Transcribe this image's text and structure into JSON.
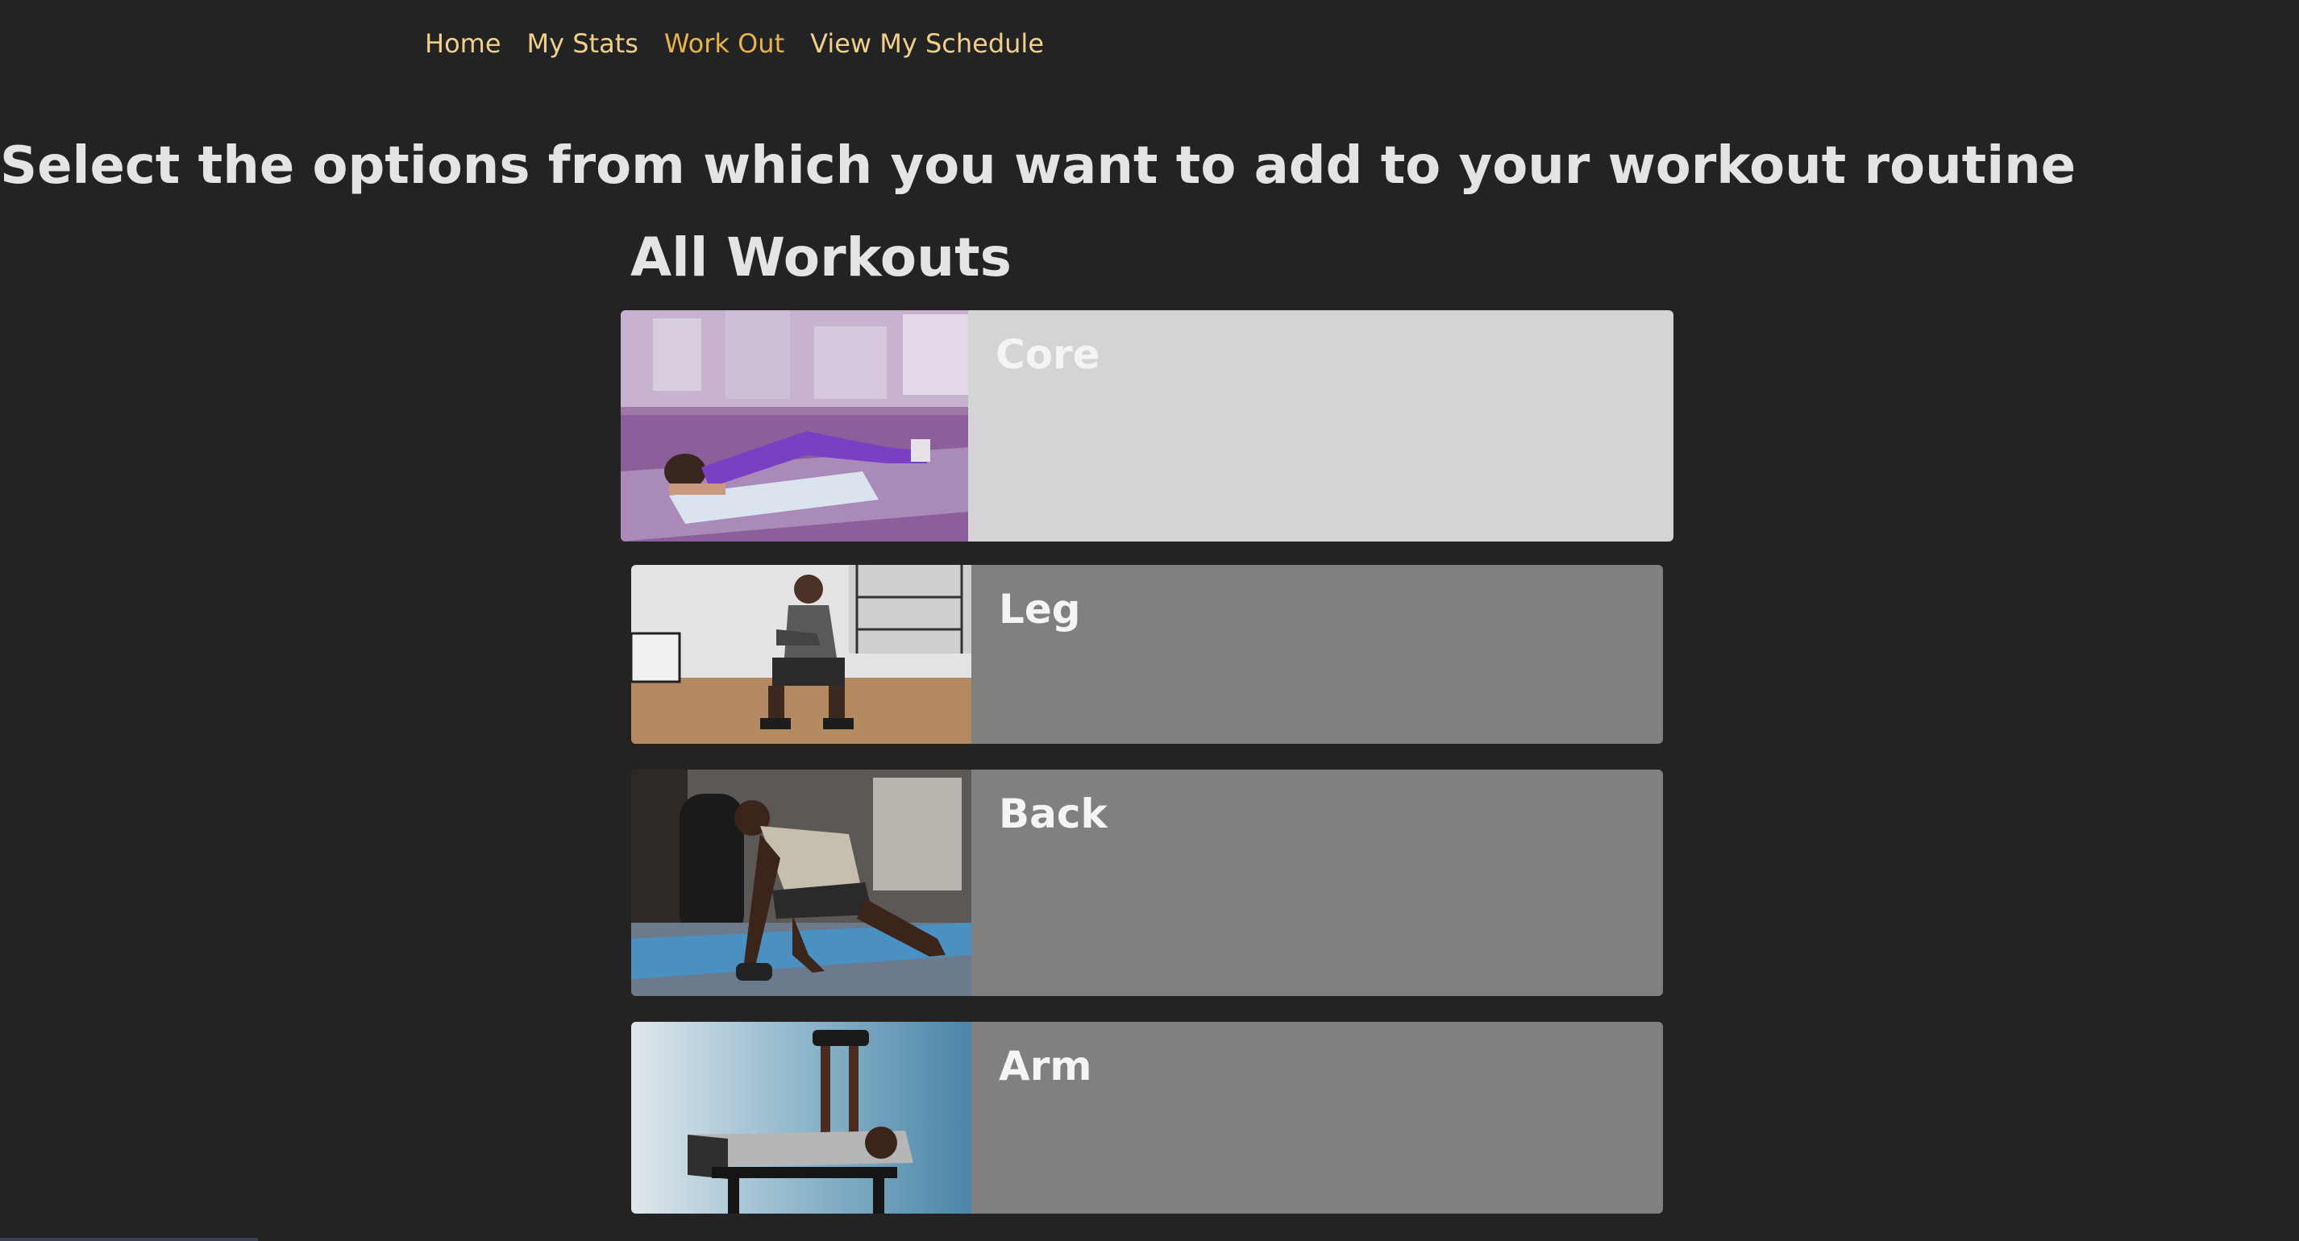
{
  "nav": {
    "items": [
      {
        "label": "Home"
      },
      {
        "label": "My Stats"
      },
      {
        "label": "Work Out"
      },
      {
        "label": "View My Schedule"
      }
    ],
    "active": "Work Out",
    "link_color": "#f2cf8a",
    "active_color": "#e8b34a"
  },
  "page": {
    "title": "Select the options from which you want to add to your workout routine",
    "section_title": "All Workouts",
    "background": "#232323"
  },
  "workouts": [
    {
      "label": "Core",
      "image": "plank-photo",
      "state": "highlighted",
      "color": "#d4d4d4"
    },
    {
      "label": "Leg",
      "image": "squat-photo",
      "color": "#808080"
    },
    {
      "label": "Back",
      "image": "dumbbell-row-photo",
      "color": "#808080"
    },
    {
      "label": "Arm",
      "image": "bench-press-photo",
      "color": "#808080"
    }
  ]
}
